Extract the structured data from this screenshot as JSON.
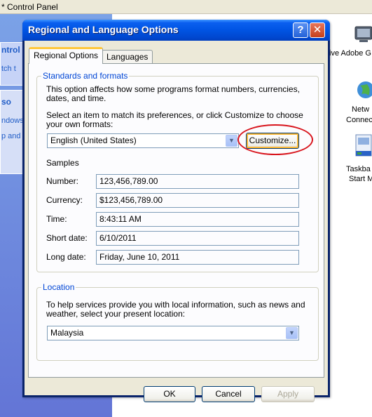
{
  "background": {
    "window_title": "* Control Panel",
    "left_pane_title": "ntrol",
    "left_pane_link": "tch t",
    "see_also_title": "so",
    "see_also_items": [
      "ndows",
      "p and"
    ],
    "icons": [
      {
        "label": "ive Adobe G",
        "icon": "adobe-icon"
      },
      {
        "label": "Netw",
        "icon": "network-icon"
      },
      {
        "label": "Connec",
        "icon": ""
      },
      {
        "label": "Taskba",
        "icon": "taskbar-icon"
      },
      {
        "label": "Start M",
        "icon": ""
      }
    ]
  },
  "dialog": {
    "title": "Regional and Language Options",
    "help_label": "?",
    "close_label": "✕",
    "tabs": [
      {
        "label": "Regional Options",
        "active": true
      },
      {
        "label": "Languages",
        "active": false
      }
    ],
    "standards": {
      "legend": "Standards and formats",
      "desc_line1": "This option affects how some programs format numbers, currencies,",
      "desc_line2": "dates, and time.",
      "select_line1": "Select an item to match its preferences, or click Customize to choose",
      "select_line2": "your own formats:",
      "format_value": "English (United States)",
      "customize_label": "Customize...",
      "samples_label": "Samples",
      "samples": [
        {
          "label": "Number:",
          "value": "123,456,789.00"
        },
        {
          "label": "Currency:",
          "value": "$123,456,789.00"
        },
        {
          "label": "Time:",
          "value": "8:43:11 AM"
        },
        {
          "label": "Short date:",
          "value": "6/10/2011"
        },
        {
          "label": "Long date:",
          "value": "Friday, June 10, 2011"
        }
      ]
    },
    "location": {
      "legend": "Location",
      "desc_line1": "To help services provide you with local information, such as news and",
      "desc_line2": "weather, select your present location:",
      "value": "Malaysia"
    },
    "buttons": {
      "ok": "OK",
      "cancel": "Cancel",
      "apply": "Apply"
    }
  },
  "colors": {
    "title_blue": "#0054e3",
    "legend_blue": "#0046d5",
    "highlight_red": "#d8141c",
    "dialog_face": "#ece9d8"
  }
}
